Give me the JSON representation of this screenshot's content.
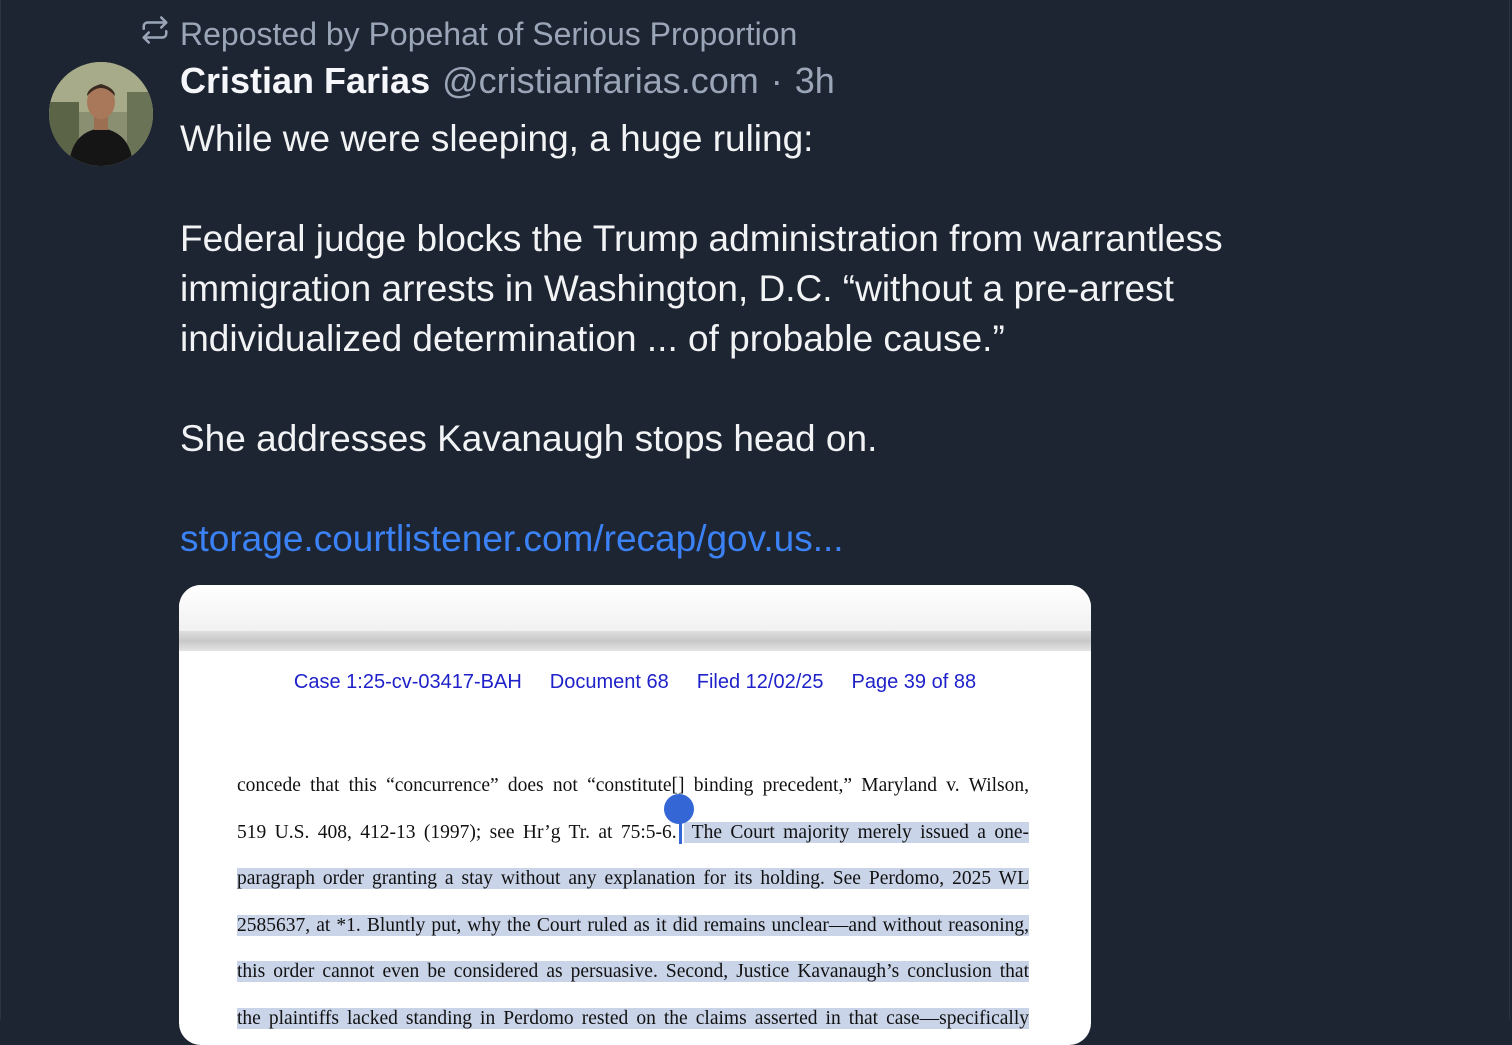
{
  "repost": {
    "text": "Reposted by Popehat of Serious Proportion",
    "icon": "repost-icon"
  },
  "author": {
    "name": "Cristian Farias",
    "handle": "@cristianfarias.com",
    "separator": "·",
    "time": "3h"
  },
  "post": {
    "p1": "While we were sleeping, a huge ruling:",
    "p2": "Federal judge blocks the Trump administration from warrantless immigration arrests in Washington, D.C. “without a pre-arrest individualized determination ... of probable cause.”",
    "p3": "She addresses Kavanaugh stops head on.",
    "link": "storage.courtlistener.com/recap/gov.us..."
  },
  "document": {
    "header": {
      "case": "Case 1:25-cv-03417-BAH",
      "doc": "Document 68",
      "filed": "Filed 12/02/25",
      "page": "Page 39 of 88"
    },
    "lines": {
      "l1": "concede that this “concurrence” does not “constitute[] binding precedent,” Maryland v. Wilson,",
      "l2a": "519 U.S. 408, 412-13 (1997); see Hr’g Tr. at 75:5-6.",
      "l2b": " The Court majority merely issued a one-",
      "l3": "paragraph order granting a stay without any explanation for its holding.  See Perdomo, 2025 WL",
      "l4": "2585637, at *1.  Bluntly put, why the Court ruled as it did remains unclear—and without reasoning,",
      "l5": "this order cannot even be considered as persuasive.  Second, Justice Kavanaugh’s conclusion that",
      "l6": "the plaintiffs lacked standing in Perdomo rested on the claims asserted in that case—specifically"
    }
  },
  "colors": {
    "background": "#1e2532",
    "link": "#3b82f6",
    "muted": "#9aa6b8",
    "doc_header": "#1f22c9",
    "highlight": "#c9d4e8"
  }
}
